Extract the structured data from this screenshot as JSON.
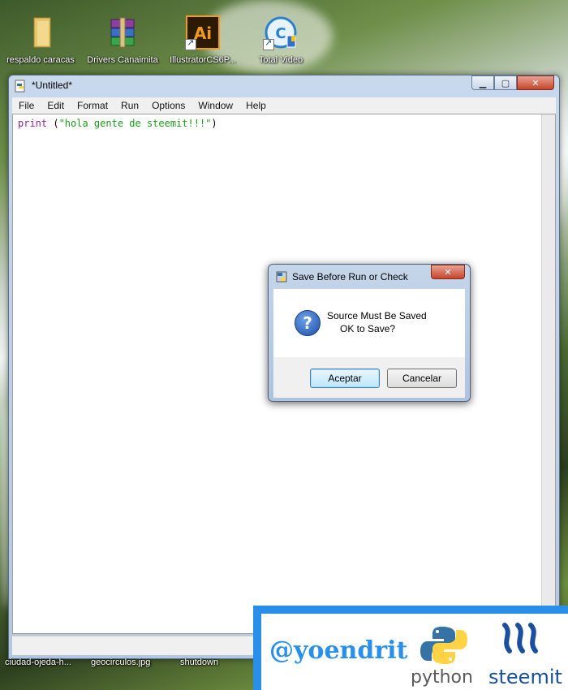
{
  "desktop": {
    "icons": [
      {
        "label": "respaldo caracas",
        "icon": "folder-icon"
      },
      {
        "label": "Drivers Canaimita",
        "icon": "winrar-archive-icon"
      },
      {
        "label": "IllustratorCS6P...",
        "icon": "illustrator-icon"
      },
      {
        "label": "Total Video",
        "icon": "total-video-icon"
      }
    ],
    "bottom_labels": [
      "ciudad-ojeda-h...",
      "geocirculos.jpg",
      "shutdown"
    ]
  },
  "window": {
    "title": "*Untitled*",
    "menu": [
      "File",
      "Edit",
      "Format",
      "Run",
      "Options",
      "Window",
      "Help"
    ],
    "code": {
      "keyword": "print",
      "open": " (",
      "string": "\"hola gente de steemit!!!\"",
      "close": ")"
    }
  },
  "dialog": {
    "title": "Save Before Run or Check",
    "message_line1": "Source Must Be Saved",
    "message_line2": "OK to Save?",
    "ok_label": "Aceptar",
    "cancel_label": "Cancelar",
    "close_glyph": "✕",
    "question_glyph": "?"
  },
  "branding": {
    "handle": "@yoendrit",
    "python_text": "python",
    "steemit_text": "steemit"
  },
  "colors": {
    "accent": "#2a8fe8",
    "python_blue": "#3673a5",
    "python_yellow": "#ffd343",
    "steemit_blue": "#1a4f9e"
  }
}
